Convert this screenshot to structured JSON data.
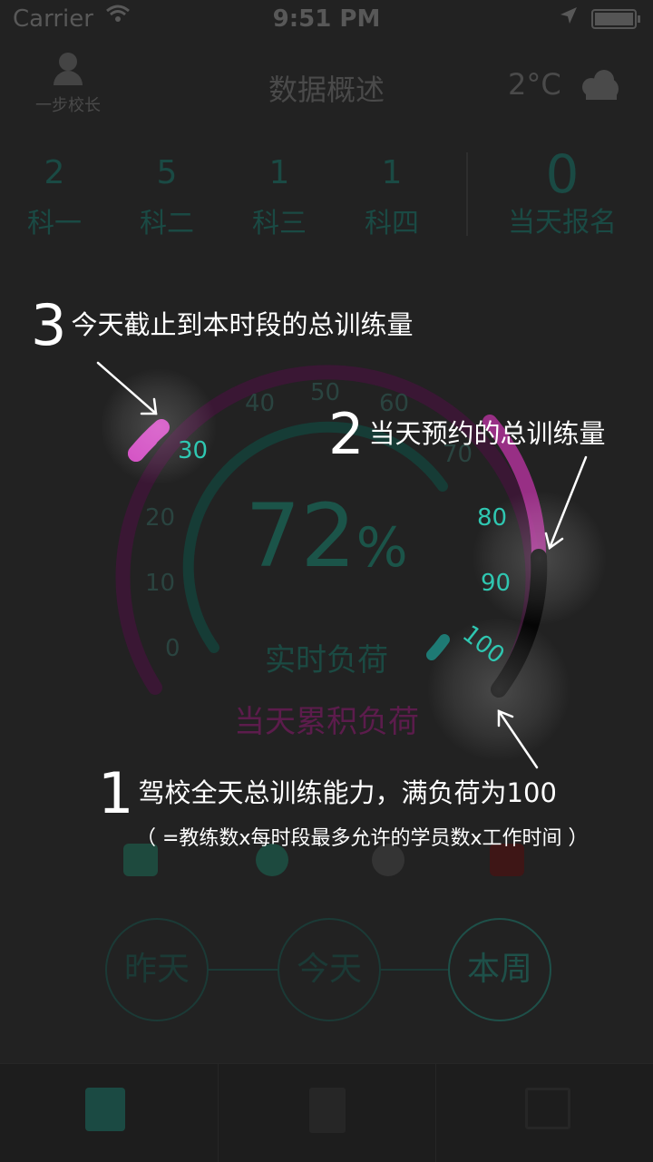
{
  "status_bar": {
    "carrier": "Carrier",
    "time": "9:51 PM"
  },
  "nav": {
    "user_name": "一步校长",
    "title": "数据概述",
    "temperature": "2°C",
    "weather_icon": "cloud-icon"
  },
  "stats": [
    {
      "value": "2",
      "label": "科一"
    },
    {
      "value": "5",
      "label": "科二"
    },
    {
      "value": "1",
      "label": "科三"
    },
    {
      "value": "1",
      "label": "科四"
    }
  ],
  "signups": {
    "value": "0",
    "label": "当天报名"
  },
  "gauge": {
    "percent": "72",
    "percent_sign": "%",
    "realtime_label": "实时负荷",
    "cumulative_label": "当天累积负荷",
    "ticks": [
      "0",
      "10",
      "20",
      "30",
      "40",
      "50",
      "60",
      "70",
      "80",
      "90",
      "100"
    ],
    "current_value": 30,
    "booked_value": 85,
    "capacity": 100,
    "colors": {
      "teal": "#1e5d52",
      "magenta": "#d04ac0",
      "dim_magenta": "#4d1c44"
    }
  },
  "periods": {
    "yesterday": "昨天",
    "today": "今天",
    "week": "本周"
  },
  "annotations": {
    "a3": {
      "num": "3",
      "text": "今天截止到本时段的总训练量"
    },
    "a2": {
      "num": "2",
      "text": "当天预约的总训练量"
    },
    "a1": {
      "num": "1",
      "text": "驾校全天总训练能力，满负荷为100",
      "note": "（ =教练数x每时段最多允许的学员数x工作时间 ）"
    }
  }
}
